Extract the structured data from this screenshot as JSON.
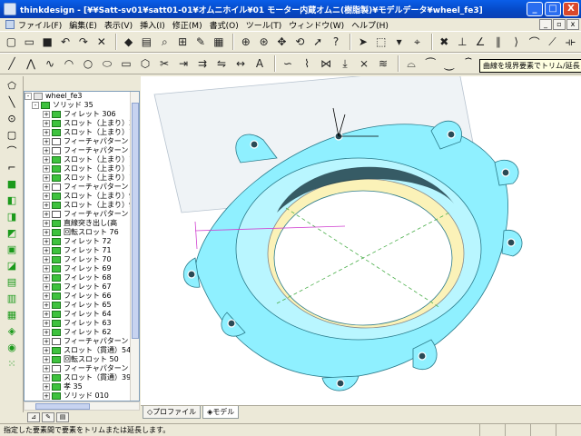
{
  "window": {
    "title": "thinkdesign  - [¥¥Satt-sv01¥satt01-01¥オムニホイル¥01 モーター内蔵オムニ(樹脂製)¥モデルデータ¥wheel_fe3]",
    "min_label": "_",
    "max_label": "□",
    "close_label": "X"
  },
  "menu": {
    "items": [
      "ファイル(F)",
      "編集(E)",
      "表示(V)",
      "挿入(I)",
      "修正(M)",
      "書式(O)",
      "ツール(T)",
      "ウィンドウ(W)",
      "ヘルプ(H)"
    ],
    "mdi_min": "_",
    "mdi_restore": "▫",
    "mdi_close": "x"
  },
  "tooltip": "曲線を境界要素でトリム/延長",
  "tree": {
    "root": "wheel_fe3",
    "solid": "ソリッド 35",
    "items": [
      {
        "label": "フィレット 306",
        "type": "feature"
      },
      {
        "label": "スロット（上まり）3(",
        "type": "feature"
      },
      {
        "label": "スロット（上まり）1:",
        "type": "feature"
      },
      {
        "label": "フィーチャパターン 1",
        "type": "pattern"
      },
      {
        "label": "フィーチャパターン 1",
        "type": "pattern"
      },
      {
        "label": "スロット（上まり）1",
        "type": "feature"
      },
      {
        "label": "スロット（上まり）1",
        "type": "feature"
      },
      {
        "label": "スロット（上まり）1(",
        "type": "feature"
      },
      {
        "label": "フィーチャパターン 9",
        "type": "pattern"
      },
      {
        "label": "スロット（上まり）9",
        "type": "feature"
      },
      {
        "label": "スロット（上まり）9",
        "type": "feature"
      },
      {
        "label": "フィーチャパターン 8",
        "type": "pattern"
      },
      {
        "label": "直線突き出し(高",
        "type": "feature"
      },
      {
        "label": "回転スロット 76",
        "type": "feature"
      },
      {
        "label": "フィレット 72",
        "type": "feature"
      },
      {
        "label": "フィレット 71",
        "type": "feature"
      },
      {
        "label": "フィレット 70",
        "type": "feature"
      },
      {
        "label": "フィレット 69",
        "type": "feature"
      },
      {
        "label": "フィレット 68",
        "type": "feature"
      },
      {
        "label": "フィレット 67",
        "type": "feature"
      },
      {
        "label": "フィレット 66",
        "type": "feature"
      },
      {
        "label": "フィレット 65",
        "type": "feature"
      },
      {
        "label": "フィレット 64",
        "type": "feature"
      },
      {
        "label": "フィレット 63",
        "type": "feature"
      },
      {
        "label": "フィレット 62",
        "type": "feature"
      },
      {
        "label": "フィーチャパターン 5",
        "type": "pattern"
      },
      {
        "label": "スロット（貫通）54",
        "type": "feature"
      },
      {
        "label": "回転スロット 50",
        "type": "feature"
      },
      {
        "label": "フィーチャパターン 4",
        "type": "pattern"
      },
      {
        "label": "スロット（貫通）39",
        "type": "feature"
      },
      {
        "label": "孝 35",
        "type": "feature"
      },
      {
        "label": "ソリッド 010",
        "type": "feature"
      }
    ]
  },
  "viewtabs": {
    "profile": "プロファイル",
    "model": "モデル"
  },
  "status": {
    "text": "指定した要素間で要素をトリムまたは延長します。"
  },
  "colors": {
    "model": "#8ff0ff",
    "highlight": "#fbf2b8",
    "construction": "#4caf4c",
    "accent": "#0a5ee8"
  }
}
